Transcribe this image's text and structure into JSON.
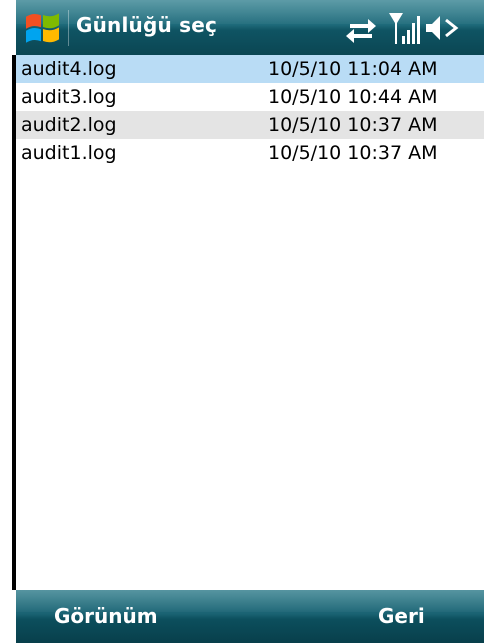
{
  "titlebar": {
    "title": "Günlüğü seç",
    "start_icon": "windows-flag-icon",
    "status_icons": [
      "connectivity-icon",
      "signal-strength-icon",
      "speaker-muted-icon"
    ]
  },
  "list": {
    "rows": [
      {
        "name": "audit4.log",
        "date": "10/5/10 11:04 AM",
        "state": "selected"
      },
      {
        "name": "audit3.log",
        "date": "10/5/10 10:44 AM",
        "state": "normal"
      },
      {
        "name": "audit2.log",
        "date": "10/5/10 10:37 AM",
        "state": "alternate"
      },
      {
        "name": "audit1.log",
        "date": "10/5/10 10:37 AM",
        "state": "normal"
      }
    ]
  },
  "softkeys": {
    "left_label": "Görünüm",
    "right_label": "Geri"
  },
  "colors": {
    "titlebar": "#1e6a7a",
    "selected_row": "#b9dcf5",
    "alternate_row": "#e4e4e4"
  }
}
